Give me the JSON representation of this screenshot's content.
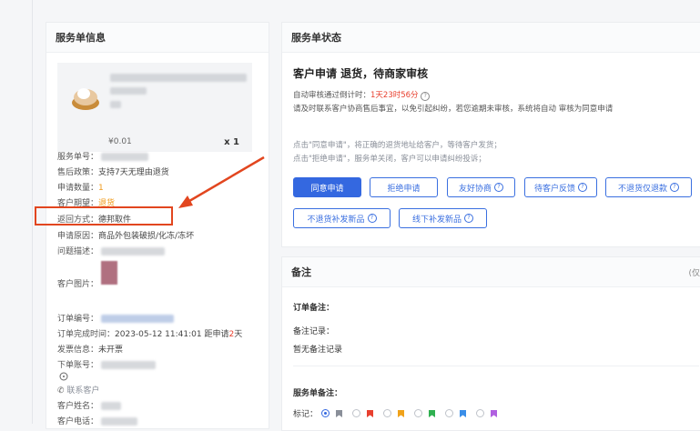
{
  "left_panel": {
    "title": "服务单信息",
    "product": {
      "price": "¥0.01",
      "qty": "x 1"
    },
    "service_no_label": "服务单号：",
    "policy_label": "售后政策：",
    "policy_value": "支持7天无理由退货",
    "apply_qty_label": "申请数量：",
    "apply_qty_value": "1",
    "expect_label": "客户期望：",
    "expect_value": "退货",
    "return_method_label": "返回方式：",
    "return_method_value": "德邦取件",
    "reason_label": "申请原因：",
    "reason_value": "商品外包装破损/化冻/冻坏",
    "desc_label": "问题描述：",
    "image_label": "客户图片：",
    "order_no_label": "订单编号：",
    "finish_time_label": "订单完成时间：",
    "finish_time_value": "2023-05-12 11:41:01",
    "distance_prefix": "距申请",
    "distance_days": "2",
    "distance_suffix": "天",
    "invoice_label": "发票信息：",
    "invoice_value": "未开票",
    "account_label": "下单账号：",
    "contact_label": "联系客户",
    "cust_name_label": "客户姓名：",
    "cust_phone_label": "客户电话："
  },
  "status_panel": {
    "title": "服务单状态",
    "headline": "客户申请 退货，待商家审核",
    "countdown_label": "自动审核通过倒计时：",
    "countdown_value": "1天23时56分",
    "notice": "请及时联系客户协商售后事宜，以免引起纠纷，若您逾期未审核，系统将自动 审核为同意申请",
    "hint1": "点击\"同意申请\"，将正确的退货地址给客户，等待客户发货；",
    "hint2": "点击\"拒绝申请\"，服务单关闭，客户可以申请纠纷投诉；",
    "buttons": [
      "同意申请",
      "拒绝申请",
      "友好协商",
      "待客户反馈",
      "不退货仅退款",
      "不退货补发新品",
      "线下补发新品"
    ]
  },
  "remark_panel": {
    "title": "备注",
    "right_hint": "(仅京",
    "order_remark_label": "订单备注：",
    "remark_record_label": "备注记录：",
    "no_record": "暂无备注记录",
    "service_remark_label": "服务单备注：",
    "flag_label": "标记：",
    "flag_colors": [
      "#8a8f99",
      "#e8402f",
      "#f0a21a",
      "#2fb050",
      "#3a8ee8",
      "#b060e0"
    ]
  }
}
